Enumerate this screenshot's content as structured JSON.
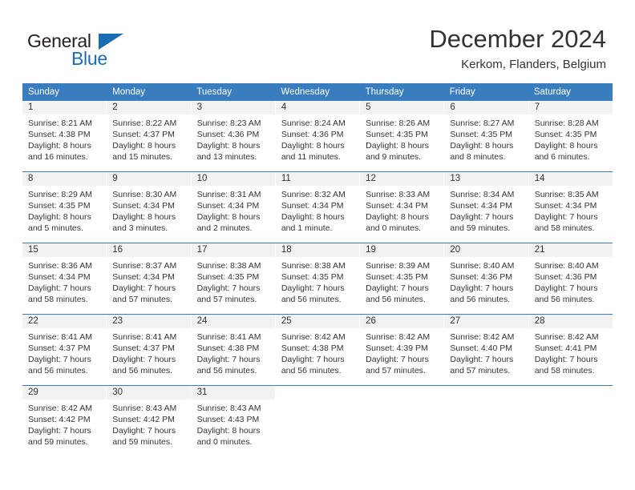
{
  "brand": {
    "word_one": "General",
    "word_two": "Blue",
    "accent_color": "#1b6cb5"
  },
  "header": {
    "month_title": "December 2024",
    "location": "Kerkom, Flanders, Belgium"
  },
  "calendar": {
    "header_color": "#3a7dbf",
    "day_band_color": "#f2f2f2",
    "day_names": [
      "Sunday",
      "Monday",
      "Tuesday",
      "Wednesday",
      "Thursday",
      "Friday",
      "Saturday"
    ],
    "weeks": [
      [
        {
          "day": "1",
          "lines": [
            "Sunrise: 8:21 AM",
            "Sunset: 4:38 PM",
            "Daylight: 8 hours",
            "and 16 minutes."
          ]
        },
        {
          "day": "2",
          "lines": [
            "Sunrise: 8:22 AM",
            "Sunset: 4:37 PM",
            "Daylight: 8 hours",
            "and 15 minutes."
          ]
        },
        {
          "day": "3",
          "lines": [
            "Sunrise: 8:23 AM",
            "Sunset: 4:36 PM",
            "Daylight: 8 hours",
            "and 13 minutes."
          ]
        },
        {
          "day": "4",
          "lines": [
            "Sunrise: 8:24 AM",
            "Sunset: 4:36 PM",
            "Daylight: 8 hours",
            "and 11 minutes."
          ]
        },
        {
          "day": "5",
          "lines": [
            "Sunrise: 8:26 AM",
            "Sunset: 4:35 PM",
            "Daylight: 8 hours",
            "and 9 minutes."
          ]
        },
        {
          "day": "6",
          "lines": [
            "Sunrise: 8:27 AM",
            "Sunset: 4:35 PM",
            "Daylight: 8 hours",
            "and 8 minutes."
          ]
        },
        {
          "day": "7",
          "lines": [
            "Sunrise: 8:28 AM",
            "Sunset: 4:35 PM",
            "Daylight: 8 hours",
            "and 6 minutes."
          ]
        }
      ],
      [
        {
          "day": "8",
          "lines": [
            "Sunrise: 8:29 AM",
            "Sunset: 4:35 PM",
            "Daylight: 8 hours",
            "and 5 minutes."
          ]
        },
        {
          "day": "9",
          "lines": [
            "Sunrise: 8:30 AM",
            "Sunset: 4:34 PM",
            "Daylight: 8 hours",
            "and 3 minutes."
          ]
        },
        {
          "day": "10",
          "lines": [
            "Sunrise: 8:31 AM",
            "Sunset: 4:34 PM",
            "Daylight: 8 hours",
            "and 2 minutes."
          ]
        },
        {
          "day": "11",
          "lines": [
            "Sunrise: 8:32 AM",
            "Sunset: 4:34 PM",
            "Daylight: 8 hours",
            "and 1 minute."
          ]
        },
        {
          "day": "12",
          "lines": [
            "Sunrise: 8:33 AM",
            "Sunset: 4:34 PM",
            "Daylight: 8 hours",
            "and 0 minutes."
          ]
        },
        {
          "day": "13",
          "lines": [
            "Sunrise: 8:34 AM",
            "Sunset: 4:34 PM",
            "Daylight: 7 hours",
            "and 59 minutes."
          ]
        },
        {
          "day": "14",
          "lines": [
            "Sunrise: 8:35 AM",
            "Sunset: 4:34 PM",
            "Daylight: 7 hours",
            "and 58 minutes."
          ]
        }
      ],
      [
        {
          "day": "15",
          "lines": [
            "Sunrise: 8:36 AM",
            "Sunset: 4:34 PM",
            "Daylight: 7 hours",
            "and 58 minutes."
          ]
        },
        {
          "day": "16",
          "lines": [
            "Sunrise: 8:37 AM",
            "Sunset: 4:34 PM",
            "Daylight: 7 hours",
            "and 57 minutes."
          ]
        },
        {
          "day": "17",
          "lines": [
            "Sunrise: 8:38 AM",
            "Sunset: 4:35 PM",
            "Daylight: 7 hours",
            "and 57 minutes."
          ]
        },
        {
          "day": "18",
          "lines": [
            "Sunrise: 8:38 AM",
            "Sunset: 4:35 PM",
            "Daylight: 7 hours",
            "and 56 minutes."
          ]
        },
        {
          "day": "19",
          "lines": [
            "Sunrise: 8:39 AM",
            "Sunset: 4:35 PM",
            "Daylight: 7 hours",
            "and 56 minutes."
          ]
        },
        {
          "day": "20",
          "lines": [
            "Sunrise: 8:40 AM",
            "Sunset: 4:36 PM",
            "Daylight: 7 hours",
            "and 56 minutes."
          ]
        },
        {
          "day": "21",
          "lines": [
            "Sunrise: 8:40 AM",
            "Sunset: 4:36 PM",
            "Daylight: 7 hours",
            "and 56 minutes."
          ]
        }
      ],
      [
        {
          "day": "22",
          "lines": [
            "Sunrise: 8:41 AM",
            "Sunset: 4:37 PM",
            "Daylight: 7 hours",
            "and 56 minutes."
          ]
        },
        {
          "day": "23",
          "lines": [
            "Sunrise: 8:41 AM",
            "Sunset: 4:37 PM",
            "Daylight: 7 hours",
            "and 56 minutes."
          ]
        },
        {
          "day": "24",
          "lines": [
            "Sunrise: 8:41 AM",
            "Sunset: 4:38 PM",
            "Daylight: 7 hours",
            "and 56 minutes."
          ]
        },
        {
          "day": "25",
          "lines": [
            "Sunrise: 8:42 AM",
            "Sunset: 4:38 PM",
            "Daylight: 7 hours",
            "and 56 minutes."
          ]
        },
        {
          "day": "26",
          "lines": [
            "Sunrise: 8:42 AM",
            "Sunset: 4:39 PM",
            "Daylight: 7 hours",
            "and 57 minutes."
          ]
        },
        {
          "day": "27",
          "lines": [
            "Sunrise: 8:42 AM",
            "Sunset: 4:40 PM",
            "Daylight: 7 hours",
            "and 57 minutes."
          ]
        },
        {
          "day": "28",
          "lines": [
            "Sunrise: 8:42 AM",
            "Sunset: 4:41 PM",
            "Daylight: 7 hours",
            "and 58 minutes."
          ]
        }
      ],
      [
        {
          "day": "29",
          "lines": [
            "Sunrise: 8:42 AM",
            "Sunset: 4:42 PM",
            "Daylight: 7 hours",
            "and 59 minutes."
          ]
        },
        {
          "day": "30",
          "lines": [
            "Sunrise: 8:43 AM",
            "Sunset: 4:42 PM",
            "Daylight: 7 hours",
            "and 59 minutes."
          ]
        },
        {
          "day": "31",
          "lines": [
            "Sunrise: 8:43 AM",
            "Sunset: 4:43 PM",
            "Daylight: 8 hours",
            "and 0 minutes."
          ]
        },
        {
          "day": "",
          "lines": []
        },
        {
          "day": "",
          "lines": []
        },
        {
          "day": "",
          "lines": []
        },
        {
          "day": "",
          "lines": []
        }
      ]
    ]
  }
}
